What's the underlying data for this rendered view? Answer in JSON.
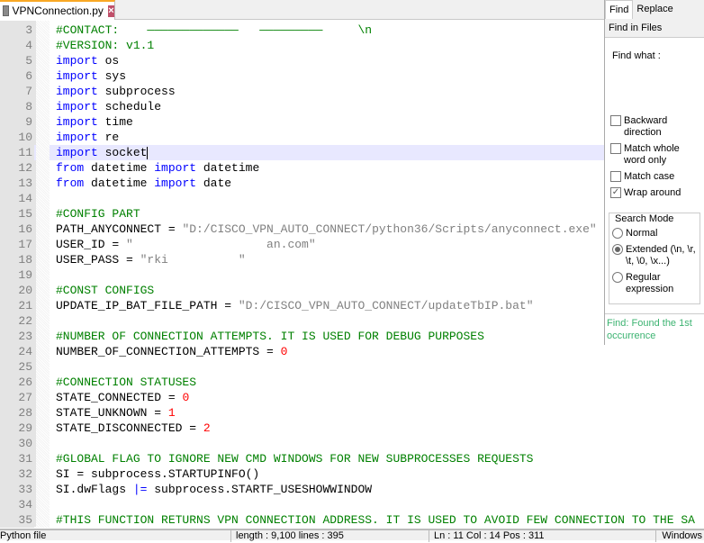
{
  "tab": {
    "title": "VPNConnection.py"
  },
  "editor": {
    "current_line": 11,
    "lines": [
      {
        "n": "3",
        "t": [
          [
            "cm",
            "#CONTACT:    "
          ],
          [
            "cm",
            "—————————————   —————————     \\n"
          ]
        ]
      },
      {
        "n": "4",
        "t": [
          [
            "cm",
            "#VERSION: v1.1"
          ]
        ]
      },
      {
        "n": "5",
        "t": [
          [
            "kw",
            "import"
          ],
          [
            "tx",
            " os"
          ]
        ]
      },
      {
        "n": "6",
        "t": [
          [
            "kw",
            "import"
          ],
          [
            "tx",
            " sys"
          ]
        ]
      },
      {
        "n": "7",
        "t": [
          [
            "kw",
            "import"
          ],
          [
            "tx",
            " subprocess"
          ]
        ]
      },
      {
        "n": "8",
        "t": [
          [
            "kw",
            "import"
          ],
          [
            "tx",
            " schedule"
          ]
        ]
      },
      {
        "n": "9",
        "t": [
          [
            "kw",
            "import"
          ],
          [
            "tx",
            " time"
          ]
        ]
      },
      {
        "n": "10",
        "t": [
          [
            "kw",
            "import"
          ],
          [
            "tx",
            " re"
          ]
        ]
      },
      {
        "n": "11",
        "t": [
          [
            "kw",
            "import"
          ],
          [
            "tx",
            " socket"
          ]
        ]
      },
      {
        "n": "12",
        "t": [
          [
            "kw",
            "from"
          ],
          [
            "tx",
            " datetime "
          ],
          [
            "kw",
            "import"
          ],
          [
            "tx",
            " datetime"
          ]
        ]
      },
      {
        "n": "13",
        "t": [
          [
            "kw",
            "from"
          ],
          [
            "tx",
            " datetime "
          ],
          [
            "kw",
            "import"
          ],
          [
            "tx",
            " date"
          ]
        ]
      },
      {
        "n": "14",
        "t": []
      },
      {
        "n": "15",
        "t": [
          [
            "cm",
            "#CONFIG PART"
          ]
        ]
      },
      {
        "n": "16",
        "t": [
          [
            "tx",
            "PATH_ANYCONNECT = "
          ],
          [
            "str",
            "\"D:/CISCO_VPN_AUTO_CONNECT/python36/Scripts/anyconnect.exe\""
          ]
        ]
      },
      {
        "n": "17",
        "t": [
          [
            "tx",
            "USER_ID = "
          ],
          [
            "str",
            "\"                   an.com\""
          ]
        ]
      },
      {
        "n": "18",
        "t": [
          [
            "tx",
            "USER_PASS = "
          ],
          [
            "str",
            "\"rki          \""
          ]
        ]
      },
      {
        "n": "19",
        "t": []
      },
      {
        "n": "20",
        "t": [
          [
            "cm",
            "#CONST CONFIGS"
          ]
        ]
      },
      {
        "n": "21",
        "t": [
          [
            "tx",
            "UPDATE_IP_BAT_FILE_PATH = "
          ],
          [
            "str",
            "\"D:/CISCO_VPN_AUTO_CONNECT/updateTbIP.bat\""
          ]
        ]
      },
      {
        "n": "22",
        "t": []
      },
      {
        "n": "23",
        "t": [
          [
            "cm",
            "#NUMBER OF CONNECTION ATTEMPTS. IT IS USED FOR DEBUG PURPOSES"
          ]
        ]
      },
      {
        "n": "24",
        "t": [
          [
            "tx",
            "NUMBER_OF_CONNECTION_ATTEMPTS = "
          ],
          [
            "num",
            "0"
          ]
        ]
      },
      {
        "n": "25",
        "t": []
      },
      {
        "n": "26",
        "t": [
          [
            "cm",
            "#CONNECTION STATUSES"
          ]
        ]
      },
      {
        "n": "27",
        "t": [
          [
            "tx",
            "STATE_CONNECTED = "
          ],
          [
            "num",
            "0"
          ]
        ]
      },
      {
        "n": "28",
        "t": [
          [
            "tx",
            "STATE_UNKNOWN = "
          ],
          [
            "num",
            "1"
          ]
        ]
      },
      {
        "n": "29",
        "t": [
          [
            "tx",
            "STATE_DISCONNECTED = "
          ],
          [
            "num",
            "2"
          ]
        ]
      },
      {
        "n": "30",
        "t": []
      },
      {
        "n": "31",
        "t": [
          [
            "cm",
            "#GLOBAL FLAG TO IGNORE NEW CMD WINDOWS FOR NEW SUBPROCESSES REQUESTS"
          ]
        ]
      },
      {
        "n": "32",
        "t": [
          [
            "tx",
            "SI = subprocess.STARTUPINFO()"
          ]
        ]
      },
      {
        "n": "33",
        "t": [
          [
            "tx",
            "SI.dwFlags "
          ],
          [
            "kw",
            "|="
          ],
          [
            "tx",
            " subprocess.STARTF_USESHOWWINDOW"
          ]
        ]
      },
      {
        "n": "34",
        "t": []
      },
      {
        "n": "35",
        "t": [
          [
            "cm",
            "#THIS FUNCTION RETURNS VPN CONNECTION ADDRESS. IT IS USED TO AVOID FEW CONNECTION TO THE SAME"
          ]
        ]
      }
    ]
  },
  "find": {
    "tabs": [
      "Find",
      "Replace",
      "Find in Files"
    ],
    "find_what": "Find what :",
    "options": [
      {
        "label": "Backward direction",
        "checked": false
      },
      {
        "label": "Match whole word only",
        "checked": false
      },
      {
        "label": "Match case",
        "checked": false
      },
      {
        "label": "Wrap around",
        "checked": true
      }
    ],
    "search_mode": {
      "label": "Search Mode",
      "options": [
        {
          "label": "Normal",
          "on": false
        },
        {
          "label": "Extended (\\n, \\r, \\t, \\0, \\x...)",
          "on": true
        },
        {
          "label": "Regular expression",
          "on": false
        }
      ]
    },
    "status": "Find: Found the 1st occurrence"
  },
  "status": {
    "type": "Python file",
    "length": "length : 9,100    lines : 395",
    "position": "Ln : 11    Col : 14    Pos : 311",
    "eol": "Windows"
  },
  "colors": {
    "keyword": "#0000ff",
    "comment": "#008000",
    "string": "#808080",
    "number": "#ff0000",
    "current_line": "#e8e8ff"
  }
}
